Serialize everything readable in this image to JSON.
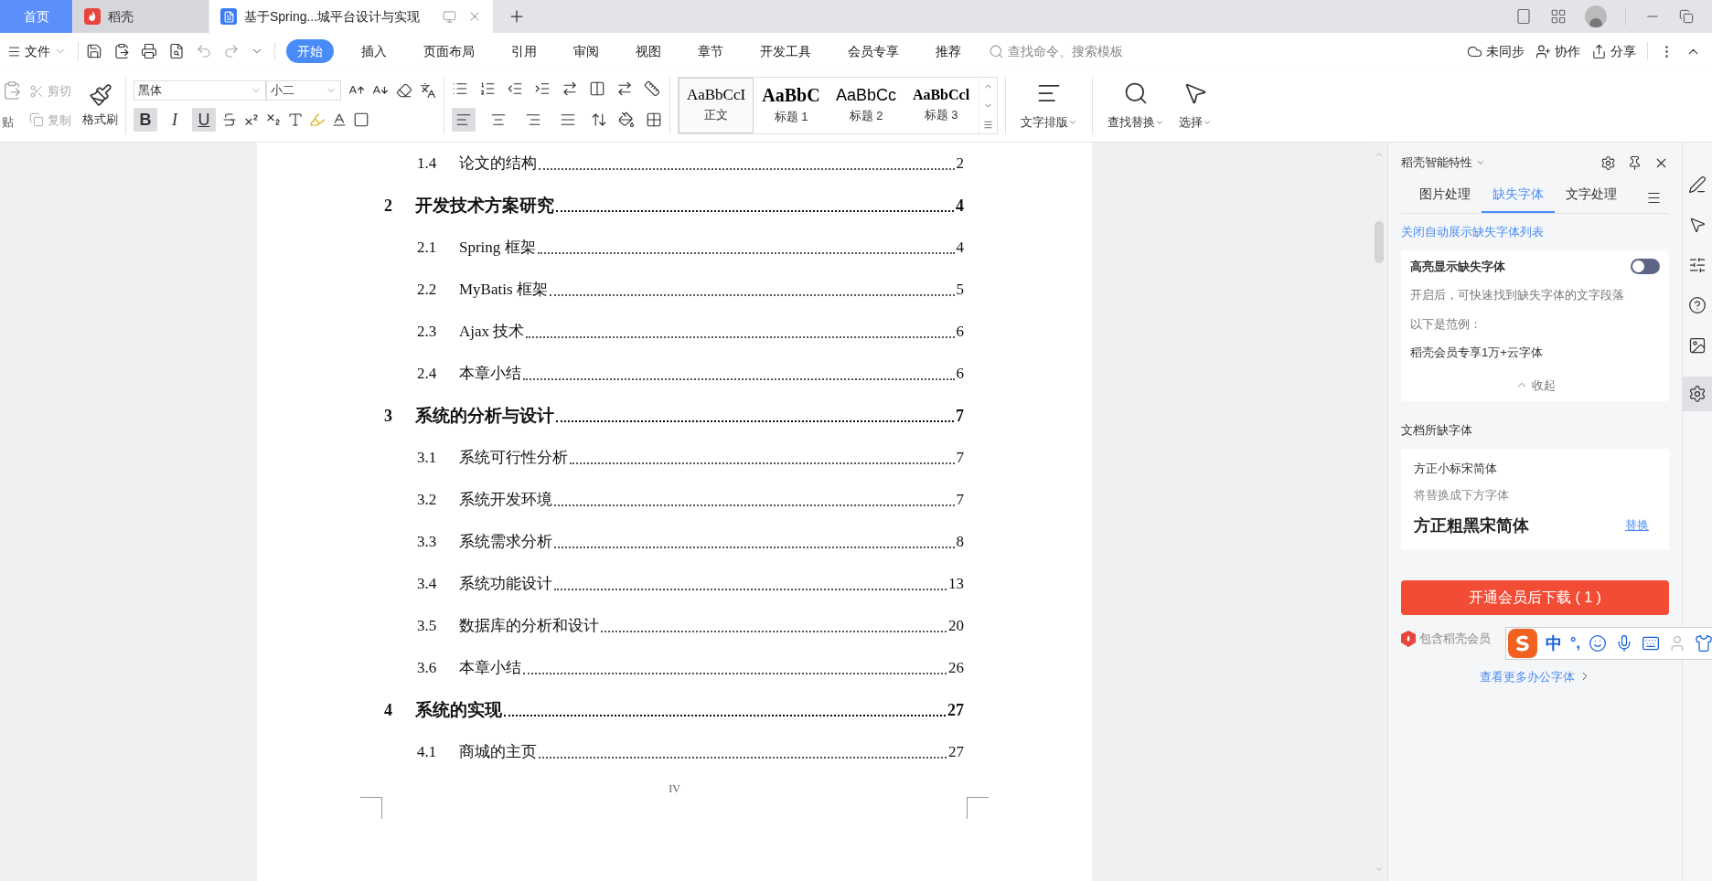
{
  "tabs": [
    {
      "label": "首页",
      "selected": false,
      "kind": "home"
    },
    {
      "label": "稻壳",
      "selected": false,
      "kind": "app"
    },
    {
      "label": "基于Spring...城平台设计与实现",
      "selected": true,
      "kind": "doc"
    }
  ],
  "menu": {
    "file": "文件",
    "items": [
      {
        "label": "开始",
        "selected": true
      },
      {
        "label": "插入",
        "selected": false
      },
      {
        "label": "页面布局",
        "selected": false
      },
      {
        "label": "引用",
        "selected": false
      },
      {
        "label": "审阅",
        "selected": false
      },
      {
        "label": "视图",
        "selected": false
      },
      {
        "label": "章节",
        "selected": false
      },
      {
        "label": "开发工具",
        "selected": false
      },
      {
        "label": "会员专享",
        "selected": false
      },
      {
        "label": "推荐",
        "selected": false
      }
    ],
    "search": {
      "placeholder": "查找命令、搜索模板"
    },
    "actions": [
      {
        "label": "未同步",
        "kind": "sync"
      },
      {
        "label": "协作",
        "kind": "collab"
      },
      {
        "label": "分享",
        "kind": "share"
      }
    ]
  },
  "ribbon": {
    "paste": "贴",
    "cut": {
      "label": "剪切",
      "disabled": true
    },
    "copy": {
      "label": "复制",
      "disabled": true
    },
    "painter": "格式刷",
    "font": "黑体",
    "size": "小二",
    "format": [
      {
        "kind": "bold",
        "label": "B",
        "on": true
      },
      {
        "kind": "italic",
        "label": "I",
        "on": false
      },
      {
        "kind": "underline",
        "label": "U",
        "on": true
      }
    ],
    "align": [
      {
        "kind": "left",
        "selected": true
      },
      {
        "kind": "center",
        "selected": false
      },
      {
        "kind": "right",
        "selected": false
      },
      {
        "kind": "justify",
        "selected": false
      }
    ],
    "styles": [
      {
        "sample": "AaBbCcI",
        "label": "正文",
        "selected": true,
        "kind": "normal"
      },
      {
        "sample": "AaBbC",
        "label": "标题 1",
        "selected": false,
        "kind": "h1"
      },
      {
        "sample": "AaBbCc",
        "label": "标题 2",
        "selected": false,
        "kind": "h2"
      },
      {
        "sample": "AaBbCcl",
        "label": "标题 3",
        "selected": false,
        "kind": "h3"
      }
    ],
    "big": [
      {
        "label": "文字排版",
        "kind": "layout"
      },
      {
        "label": "查找替换",
        "kind": "find"
      },
      {
        "label": "选择",
        "kind": "select"
      }
    ]
  },
  "toc": [
    {
      "kind": "section",
      "number": "1.4",
      "title": "论文的结构",
      "page": "2"
    },
    {
      "kind": "chapter",
      "number": "2",
      "title": "开发技术方案研究",
      "page": "4"
    },
    {
      "kind": "section",
      "number": "2.1",
      "title": "Spring 框架",
      "page": "4"
    },
    {
      "kind": "section",
      "number": "2.2",
      "title": "MyBatis 框架",
      "page": "5"
    },
    {
      "kind": "section",
      "number": "2.3",
      "title": "Ajax 技术",
      "page": "6"
    },
    {
      "kind": "section",
      "number": "2.4",
      "title": "本章小结",
      "page": "6"
    },
    {
      "kind": "chapter",
      "number": "3",
      "title": "系统的分析与设计",
      "page": "7"
    },
    {
      "kind": "section",
      "number": "3.1",
      "title": "系统可行性分析",
      "page": "7"
    },
    {
      "kind": "section",
      "number": "3.2",
      "title": "系统开发环境",
      "page": "7"
    },
    {
      "kind": "section",
      "number": "3.3",
      "title": "系统需求分析",
      "page": "8"
    },
    {
      "kind": "section",
      "number": "3.4",
      "title": "系统功能设计",
      "page": "13"
    },
    {
      "kind": "section",
      "number": "3.5",
      "title": "数据库的分析和设计",
      "page": "20"
    },
    {
      "kind": "section",
      "number": "3.6",
      "title": "本章小结",
      "page": "26"
    },
    {
      "kind": "chapter",
      "number": "4",
      "title": "系统的实现",
      "page": "27"
    },
    {
      "kind": "section",
      "number": "4.1",
      "title": "商城的主页",
      "page": "27"
    }
  ],
  "page_number": "IV",
  "panel": {
    "title": "稻壳智能特性",
    "tabs": [
      {
        "label": "图片处理",
        "selected": false
      },
      {
        "label": "缺失字体",
        "selected": true
      },
      {
        "label": "文字处理",
        "selected": false
      }
    ],
    "link": "关闭自动展示缺失字体列表",
    "highlight": {
      "title": "高亮显示缺失字体",
      "on": false,
      "desc": "开启后，可快速找到缺失字体的文字段落",
      "example_label": "以下是范例：",
      "example": "稻壳会员专享1万+云字体",
      "collapse": "收起"
    },
    "missing_title": "文档所缺字体",
    "missing": [
      {
        "name": "方正小标宋简体",
        "hint": "将替换成下方字体",
        "replacement": "方正粗黑宋简体",
        "action": "替换"
      }
    ],
    "download": "开通会员后下载 ( 1 )",
    "member_note": "包含稻壳会员",
    "more": "查看更多办公字体"
  },
  "ime": {
    "mode": "中",
    "punct": "°,"
  }
}
